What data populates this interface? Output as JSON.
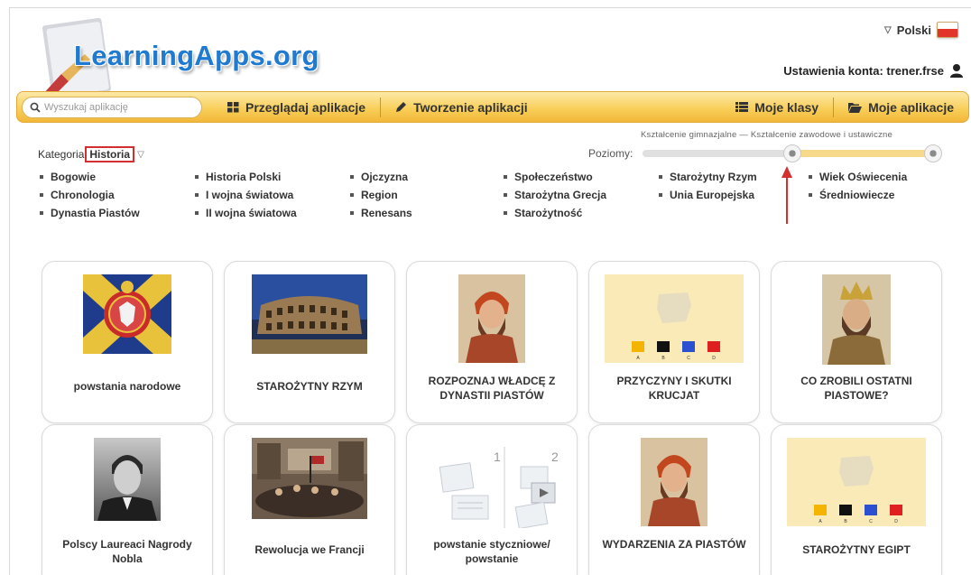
{
  "site": {
    "logo_text": "LearningApps.org"
  },
  "header": {
    "language": "Polski",
    "account_text": "Ustawienia konta: trener.frse"
  },
  "nav": {
    "search_placeholder": "Wyszukaj aplikację",
    "browse": "Przeglądaj aplikacje",
    "create": "Tworzenie aplikacji",
    "classes": "Moje klasy",
    "my_apps": "Moje aplikacje"
  },
  "filter": {
    "category_label": "Kategoria",
    "category_value": "Historia",
    "levels_label": "Poziomy:",
    "levels_range": "Kształcenie gimnazjalne — Kształcenie zawodowe i ustawiczne"
  },
  "topics": [
    [
      "Bogowie",
      "Chronologia",
      "Dynastia Piastów"
    ],
    [
      "Historia Polski",
      "I wojna światowa",
      "II wojna światowa"
    ],
    [
      "Ojczyzna",
      "Region",
      "Renesans"
    ],
    [
      "Społeczeństwo",
      "Starożytna Grecja",
      "Starożytność"
    ],
    [
      "Starożytny Rzym",
      "Unia Europejska"
    ],
    [
      "Wiek Oświecenia",
      "Średniowiecze"
    ]
  ],
  "apps": [
    {
      "title": "powstania narodowe",
      "thumb": "military-flag-eagle"
    },
    {
      "title": "STAROŻYTNY RZYM",
      "thumb": "colosseum-photo"
    },
    {
      "title": "ROZPOZNAJ WŁADCĘ Z DYNASTII PIASTÓW",
      "thumb": "king-portrait"
    },
    {
      "title": "PRZYCZYNY I SKUTKI KRUCJAT",
      "thumb": "colored-squares-map"
    },
    {
      "title": "CO ZROBILI OSTATNI PIASTOWE?",
      "thumb": "crowned-king-portrait"
    },
    {
      "title": "Polscy Laureaci Nagrody Nobla",
      "thumb": "man-portrait-bw"
    },
    {
      "title": "Rewolucja we Francji",
      "thumb": "revolution-painting"
    },
    {
      "title": "powstanie styczniowe/ powstanie",
      "thumb": "app-template-placeholder"
    },
    {
      "title": "WYDARZENIA ZA PIASTÓW",
      "thumb": "king-portrait"
    },
    {
      "title": "STAROŻYTNY EGIPT",
      "thumb": "colored-squares-map"
    }
  ],
  "square_labels": [
    "A",
    "B",
    "C",
    "D"
  ],
  "template_numbers": [
    "1",
    "2"
  ],
  "colors": {
    "nav_bar": "#f8cd55",
    "logo_blue": "#1f7ad1",
    "highlight_red": "#d32f2f"
  }
}
